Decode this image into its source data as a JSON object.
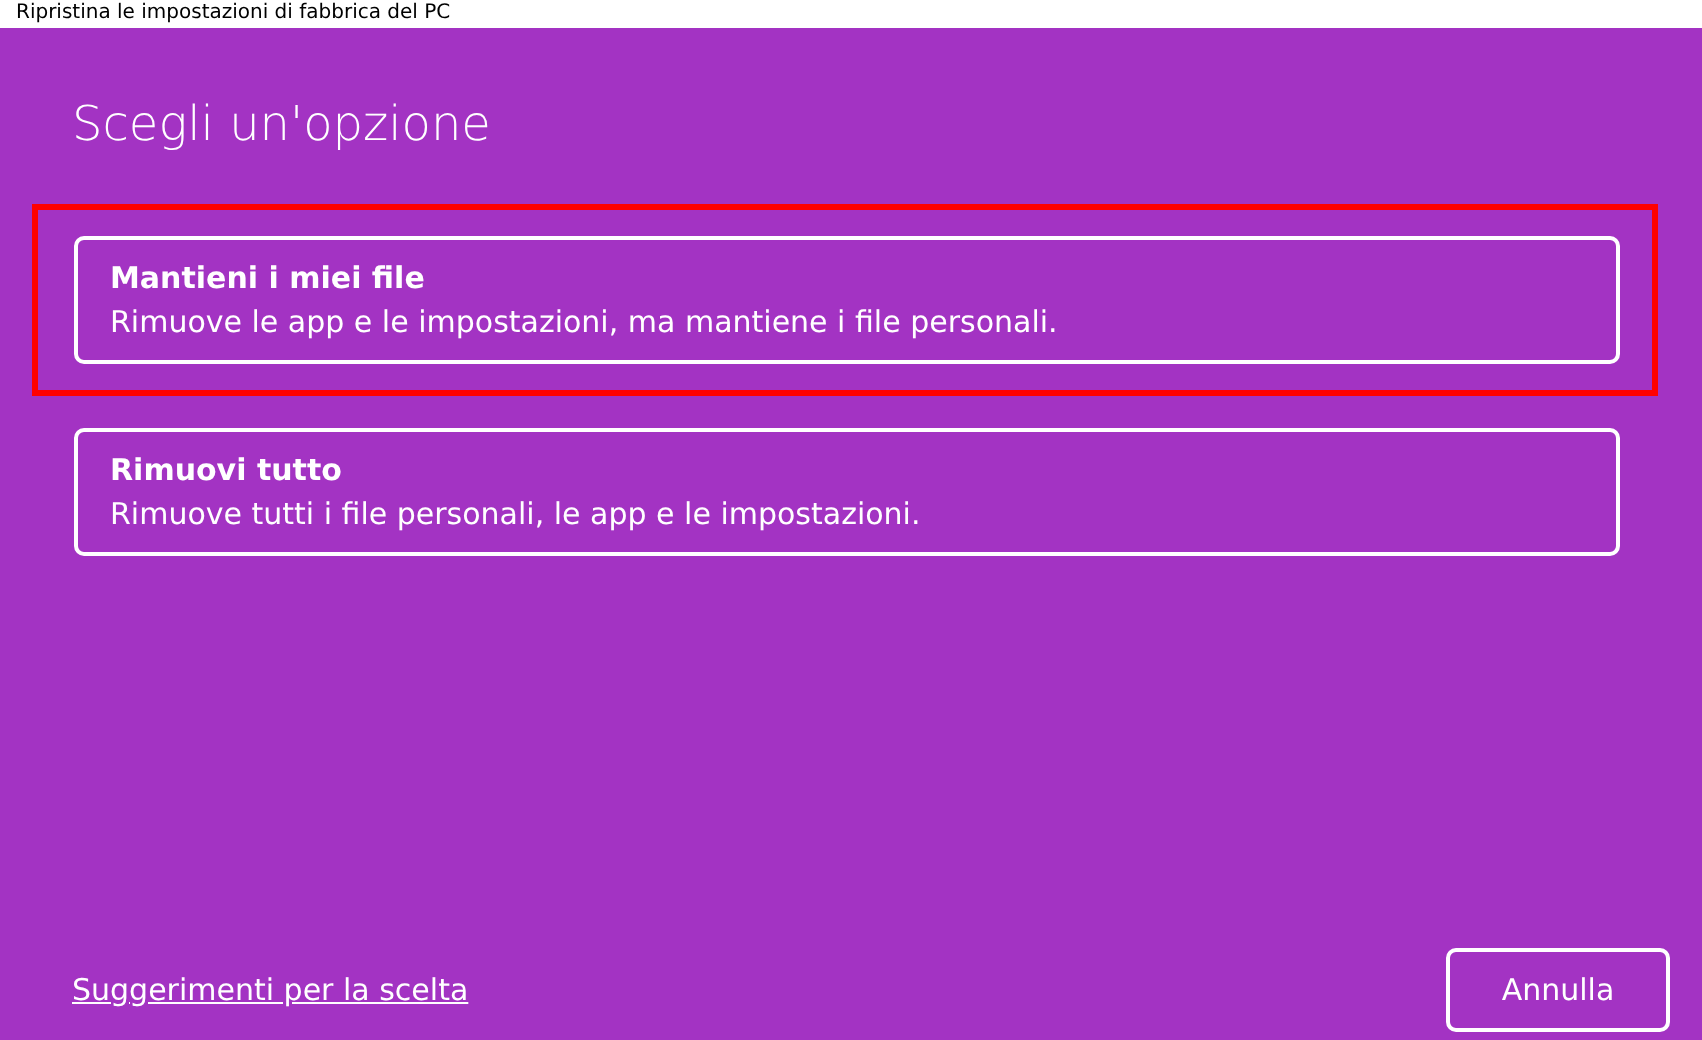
{
  "window": {
    "title": "Ripristina le impostazioni di fabbrica del PC"
  },
  "heading": "Scegli un'opzione",
  "options": [
    {
      "title": "Mantieni i miei file",
      "description": "Rimuove le app e le impostazioni, ma mantiene i file personali.",
      "highlighted": true
    },
    {
      "title": "Rimuovi tutto",
      "description": "Rimuove tutti i file personali, le app e le impostazioni.",
      "highlighted": false
    }
  ],
  "help_link": "Suggerimenti per la scelta",
  "buttons": [
    "Annulla"
  ]
}
